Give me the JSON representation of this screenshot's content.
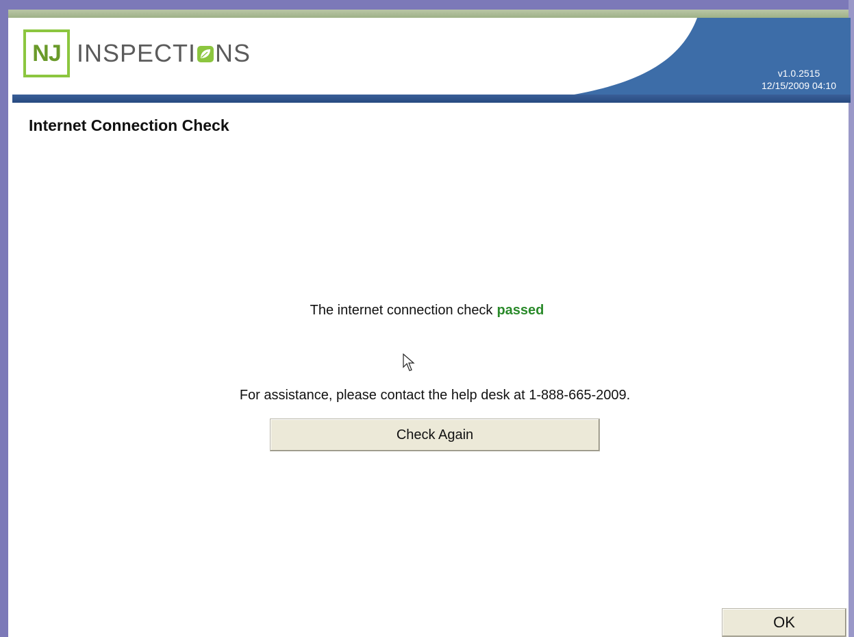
{
  "app": {
    "logo_initials": "NJ",
    "logo_word_before": "INSPECTI",
    "logo_word_after": "NS",
    "version": "v1.0.2515",
    "datetime": "12/15/2009 04:10"
  },
  "page": {
    "title": "Internet Connection Check",
    "status_prefix": "The internet connection check",
    "status_result": "passed",
    "help_text": "For assistance, please contact the help desk at 1-888-665-2009."
  },
  "buttons": {
    "check_again": "Check Again",
    "ok": "OK"
  },
  "colors": {
    "frame": "#7c79b8",
    "header_blue": "#3d6da8",
    "logo_green": "#8cc63f",
    "passed_green": "#2a8a2a",
    "button_face": "#ece9d8"
  },
  "icons": {
    "cursor": "mouse-pointer-icon",
    "logo_leaf": "leaf-icon"
  }
}
